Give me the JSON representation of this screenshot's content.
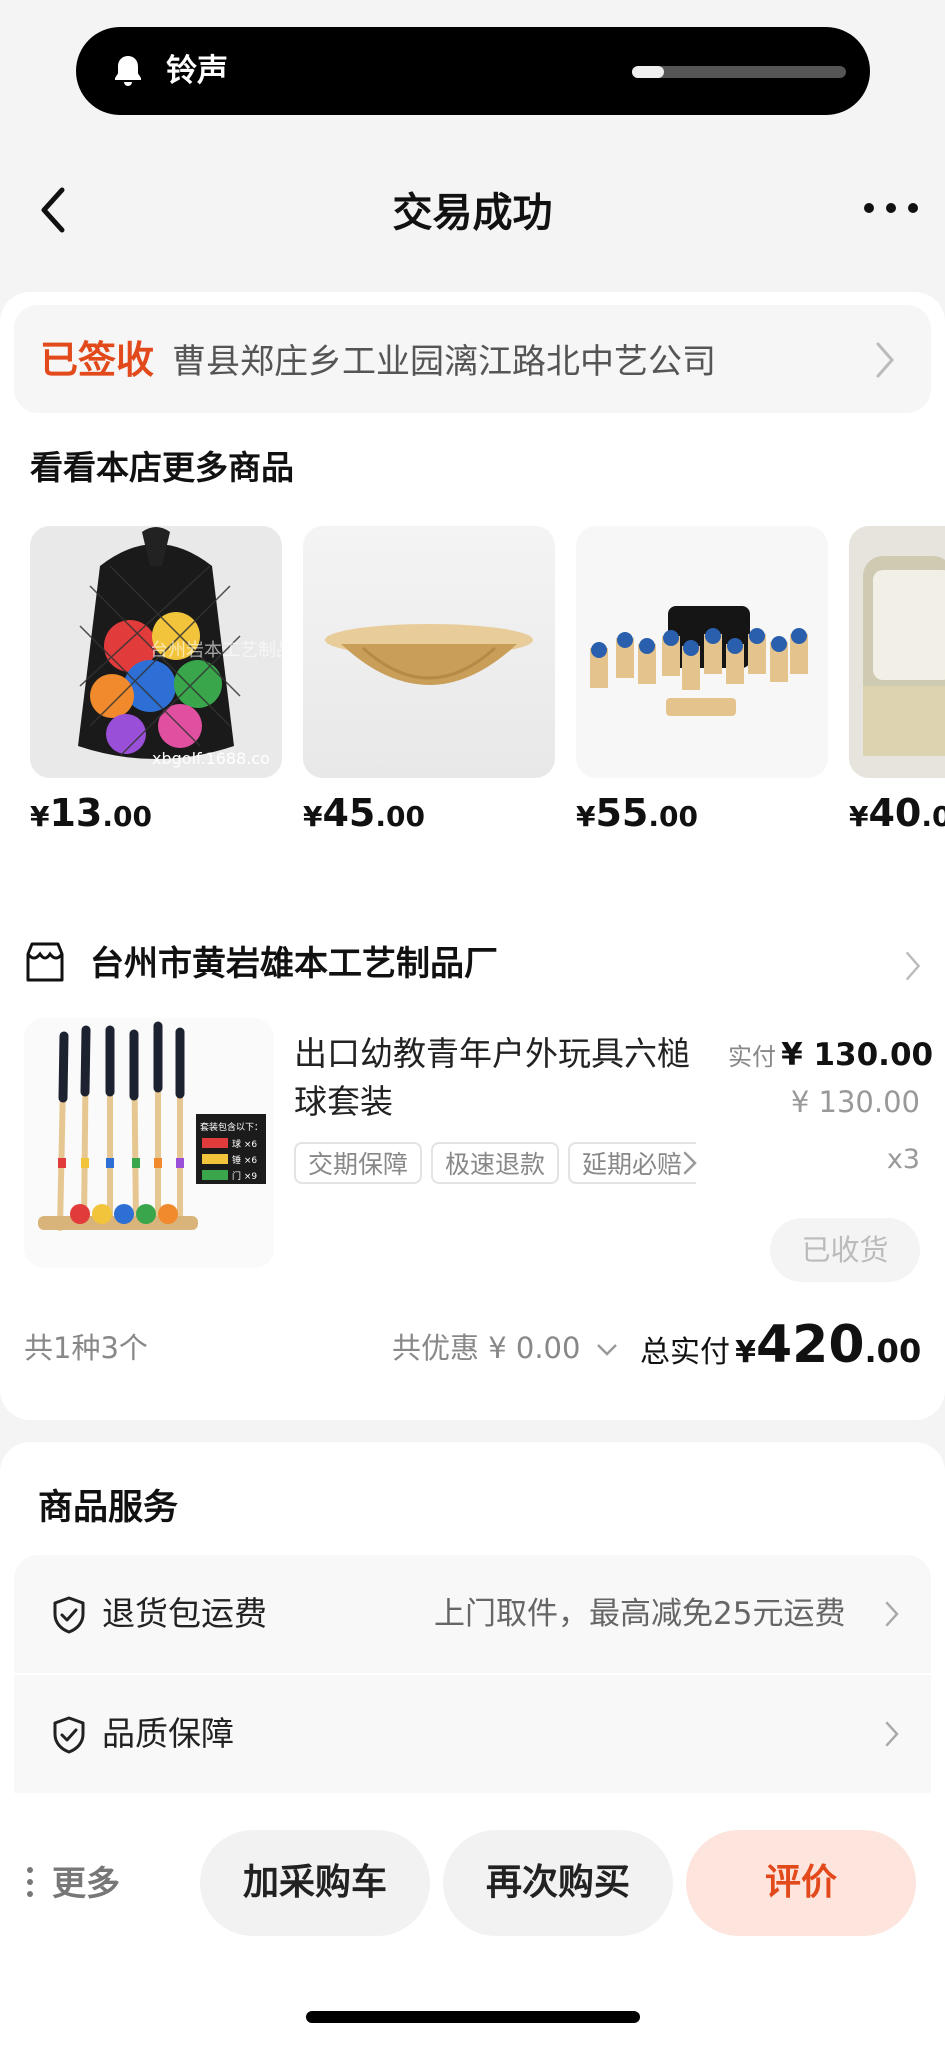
{
  "status_bar": {
    "ringer_label": "铃声",
    "ringer_level": 0.15
  },
  "header": {
    "title": "交易成功"
  },
  "address": {
    "status": "已签收",
    "text": "曹县郑庄乡工业园漓江路北中艺公司"
  },
  "recommend": {
    "title": "看看本店更多商品",
    "items": [
      {
        "currency": "¥",
        "price_int": "13",
        "price_dec": ".00",
        "watermark": "xbgolf.1688.co",
        "watermark2": "台州岩本工艺制品厂"
      },
      {
        "currency": "¥",
        "price_int": "45",
        "price_dec": ".00"
      },
      {
        "currency": "¥",
        "price_int": "55",
        "price_dec": ".00"
      },
      {
        "currency": "¥",
        "price_int": "40",
        "price_dec": ".0"
      }
    ]
  },
  "order": {
    "shop_name": "台州市黄岩雄本工艺制品厂",
    "product": {
      "title": "出口幼教青年户外玩具六槌球套装",
      "pay_label": "实付",
      "pay_value": "¥ 130.00",
      "original_price": "¥ 130.00",
      "quantity": "x3",
      "tags": [
        "交期保障",
        "极速退款",
        "延期必赔"
      ],
      "image_text": [
        "套装包含以下：",
        "球 ×6",
        "锤 ×6",
        "门 ×9"
      ],
      "received_label": "已收货"
    },
    "summary": {
      "count": "共1种3个",
      "discount": "共优惠 ¥ 0.00",
      "total_label": "总实付",
      "total_currency": "¥",
      "total_int": "420",
      "total_dec": ".00"
    }
  },
  "services": {
    "title": "商品服务",
    "rows": [
      {
        "label": "退货包运费",
        "desc": "上门取件，最高减免25元运费"
      },
      {
        "label": "品质保障",
        "desc": ""
      }
    ]
  },
  "bottom_bar": {
    "more_label": "更多",
    "add_cart": "加采购车",
    "buy_again": "再次购买",
    "review": "评价"
  },
  "colors": {
    "accent": "#e2491b",
    "review_bg": "#fde4dc",
    "background": "#f4f4f4"
  }
}
